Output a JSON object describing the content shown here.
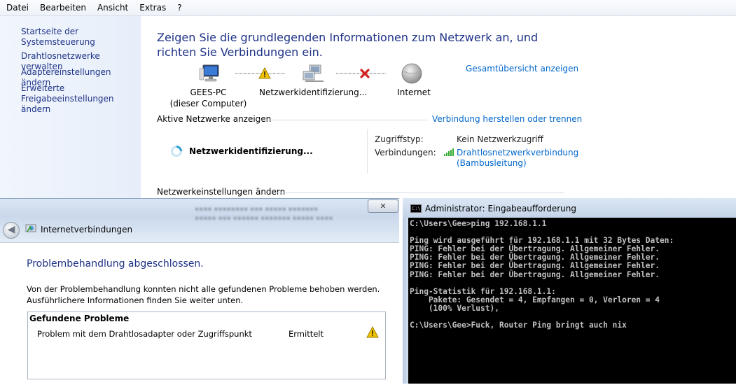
{
  "menu": [
    "Datei",
    "Bearbeiten",
    "Ansicht",
    "Extras",
    "?"
  ],
  "sidebar": {
    "items": [
      {
        "label": "Startseite der Systemsteuerung"
      },
      {
        "label": "Drahtlosnetzwerke verwalten"
      },
      {
        "label": "Adaptereinstellungen ändern"
      },
      {
        "label": "Erweiterte"
      },
      {
        "label": "Freigabeeinstellungen ändern"
      }
    ]
  },
  "network": {
    "title": "Zeigen Sie die grundlegenden Informationen zum Netzwerk an, und richten Sie Verbindungen ein.",
    "overview_link": "Gesamtübersicht anzeigen",
    "map": {
      "computer_label": "GEES-PC",
      "computer_sub": "(dieser Computer)",
      "network_label": "Netzwerkidentifizierung...",
      "internet_label": "Internet"
    },
    "active_header": "Aktive Netzwerke anzeigen",
    "connect_link": "Verbindung herstellen oder trennen",
    "identifying": "Netzwerkidentifizierung...",
    "access_type_label": "Zugriffstyp:",
    "access_type_value": "Kein Netzwerkzugriff",
    "connections_label": "Verbindungen:",
    "connection_name": "Drahtlosnetzwerkverbindung",
    "connection_sub": "(Bambusleitung)",
    "settings_header": "Netzwerkeinstellungen ändern"
  },
  "troubleshooter": {
    "close": "✕",
    "window_title": "Internetverbindungen",
    "heading": "Problembehandlung abgeschlossen.",
    "text_line1": "Von der Problembehandlung konnten nicht alle gefundenen Probleme behoben werden.",
    "text_line2": "Ausführlichere Informationen finden Sie weiter unten.",
    "found_header": "Gefundene Probleme",
    "problems": [
      {
        "name": "Problem mit dem Drahtlosadapter oder Zugriffspunkt",
        "status": "Ermittelt",
        "icon": "warning-icon"
      }
    ]
  },
  "cmd": {
    "title": "Administrator: Eingabeaufforderung",
    "icon_text": "C:\\",
    "lines": [
      "C:\\Users\\Gee>ping 192.168.1.1",
      "",
      "Ping wird ausgeführt für 192.168.1.1 mit 32 Bytes Daten:",
      "PING: Fehler bei der Übertragung. Allgemeiner Fehler.",
      "PING: Fehler bei der Übertragung. Allgemeiner Fehler.",
      "PING: Fehler bei der Übertragung. Allgemeiner Fehler.",
      "PING: Fehler bei der Übertragung. Allgemeiner Fehler.",
      "",
      "Ping-Statistik für 192.168.1.1:",
      "    Pakete: Gesendet = 4, Empfangen = 0, Verloren = 4",
      "    (100% Verlust),",
      "",
      "C:\\Users\\Gee>Fuck, Router Ping bringt auch nix"
    ]
  },
  "colors": {
    "link": "#0066cc",
    "title": "#1e3287",
    "warning": "#f5c400",
    "error": "#d42020",
    "console_bg": "#000000",
    "console_fg": "#c0c0c0"
  }
}
